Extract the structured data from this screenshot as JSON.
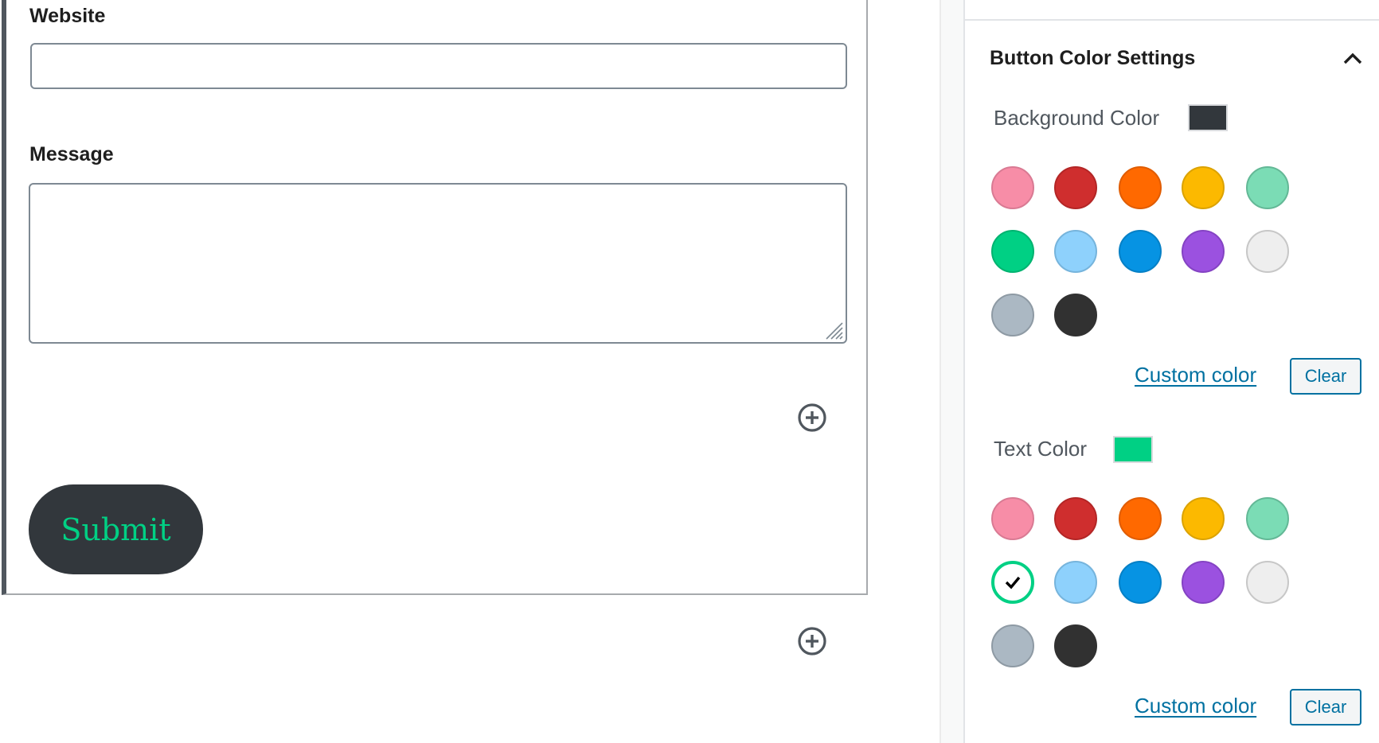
{
  "form": {
    "website_label": "Website",
    "website_value": "",
    "message_label": "Message",
    "message_value": "",
    "submit_label": "Submit",
    "submit_bg_color": "#32373c",
    "submit_text_color": "#00d084"
  },
  "sidebar": {
    "panel_title": "Button Color Settings",
    "panel_expanded": true,
    "background_color": {
      "label": "Background Color",
      "current": "#32373c",
      "custom_color_label": "Custom color",
      "clear_label": "Clear",
      "selected_index": null
    },
    "text_color": {
      "label": "Text Color",
      "current": "#00d084",
      "custom_color_label": "Custom color",
      "clear_label": "Clear",
      "selected_index": 5
    },
    "palette": [
      {
        "name": "Pale pink",
        "color": "#f78da7",
        "border": "#d97a93"
      },
      {
        "name": "Vivid red",
        "color": "#cf2e2e",
        "border": "#b32626"
      },
      {
        "name": "Luminous vivid orange",
        "color": "#ff6900",
        "border": "#e05c00"
      },
      {
        "name": "Luminous vivid amber",
        "color": "#fcb900",
        "border": "#dba200"
      },
      {
        "name": "Light green cyan",
        "color": "#7bdcb5",
        "border": "#63b896"
      },
      {
        "name": "Vivid green cyan",
        "color": "#00d084",
        "border": "#00b370"
      },
      {
        "name": "Pale cyan blue",
        "color": "#8ed1fc",
        "border": "#76b4dc"
      },
      {
        "name": "Vivid cyan blue",
        "color": "#0693e3",
        "border": "#0580c6"
      },
      {
        "name": "Vivid purple",
        "color": "#9b51e0",
        "border": "#8443c3"
      },
      {
        "name": "Very light gray",
        "color": "#eeeeee",
        "border": "#c7c7c7"
      },
      {
        "name": "Cyan bluish gray",
        "color": "#abb8c3",
        "border": "#8e9aa4"
      },
      {
        "name": "Very dark gray",
        "color": "#313131",
        "border": "#313131"
      }
    ]
  }
}
